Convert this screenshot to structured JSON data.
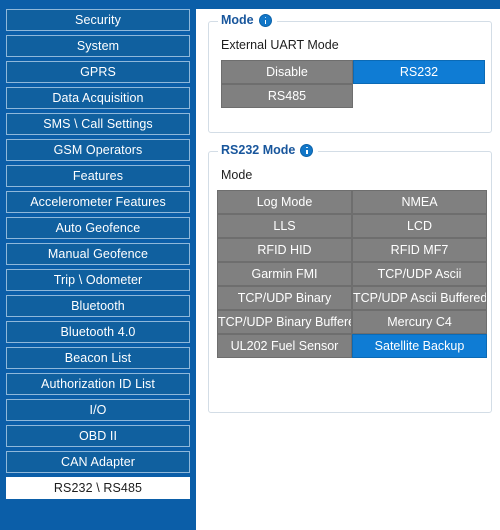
{
  "sidebar": {
    "items": [
      {
        "label": "Security",
        "selected": false
      },
      {
        "label": "System",
        "selected": false
      },
      {
        "label": "GPRS",
        "selected": false
      },
      {
        "label": "Data Acquisition",
        "selected": false
      },
      {
        "label": "SMS \\ Call Settings",
        "selected": false
      },
      {
        "label": "GSM Operators",
        "selected": false
      },
      {
        "label": "Features",
        "selected": false
      },
      {
        "label": "Accelerometer Features",
        "selected": false
      },
      {
        "label": "Auto Geofence",
        "selected": false
      },
      {
        "label": "Manual Geofence",
        "selected": false
      },
      {
        "label": "Trip \\ Odometer",
        "selected": false
      },
      {
        "label": "Bluetooth",
        "selected": false
      },
      {
        "label": "Bluetooth 4.0",
        "selected": false
      },
      {
        "label": "Beacon List",
        "selected": false
      },
      {
        "label": "Authorization ID List",
        "selected": false
      },
      {
        "label": "I/O",
        "selected": false
      },
      {
        "label": "OBD II",
        "selected": false
      },
      {
        "label": "CAN Adapter",
        "selected": false
      },
      {
        "label": "RS232 \\ RS485",
        "selected": true
      }
    ]
  },
  "mode_panel": {
    "legend": "Mode",
    "info_icon": "info-icon",
    "sub_label": "External UART Mode",
    "options": [
      {
        "label": "Disable",
        "active": false
      },
      {
        "label": "RS232",
        "active": true
      },
      {
        "label": "RS485",
        "active": false
      }
    ]
  },
  "rs232_panel": {
    "legend": "RS232 Mode",
    "info_icon": "info-icon",
    "sub_label": "Mode",
    "options": [
      {
        "label": "Log Mode",
        "active": false
      },
      {
        "label": "NMEA",
        "active": false
      },
      {
        "label": "LLS",
        "active": false
      },
      {
        "label": "LCD",
        "active": false
      },
      {
        "label": "RFID HID",
        "active": false
      },
      {
        "label": "RFID MF7",
        "active": false
      },
      {
        "label": "Garmin FMI",
        "active": false
      },
      {
        "label": "TCP/UDP Ascii",
        "active": false
      },
      {
        "label": "TCP/UDP Binary",
        "active": false
      },
      {
        "label": "TCP/UDP Ascii Buffered",
        "active": false
      },
      {
        "label": "TCP/UDP Binary Buffered",
        "active": false
      },
      {
        "label": "Mercury C4",
        "active": false
      },
      {
        "label": "UL202 Fuel Sensor",
        "active": false
      },
      {
        "label": "Satellite Backup",
        "active": true
      }
    ]
  },
  "colors": {
    "sidebar_bg": "#0b5ea8",
    "nav_btn_bg": "#10609f",
    "nav_btn_border": "#8fb8da",
    "nav_selected_bg": "#ffffff",
    "accent_blue": "#0f7cd4",
    "inactive_gray": "#808080",
    "legend_text": "#18569c",
    "panel_border": "#d3dde6"
  }
}
